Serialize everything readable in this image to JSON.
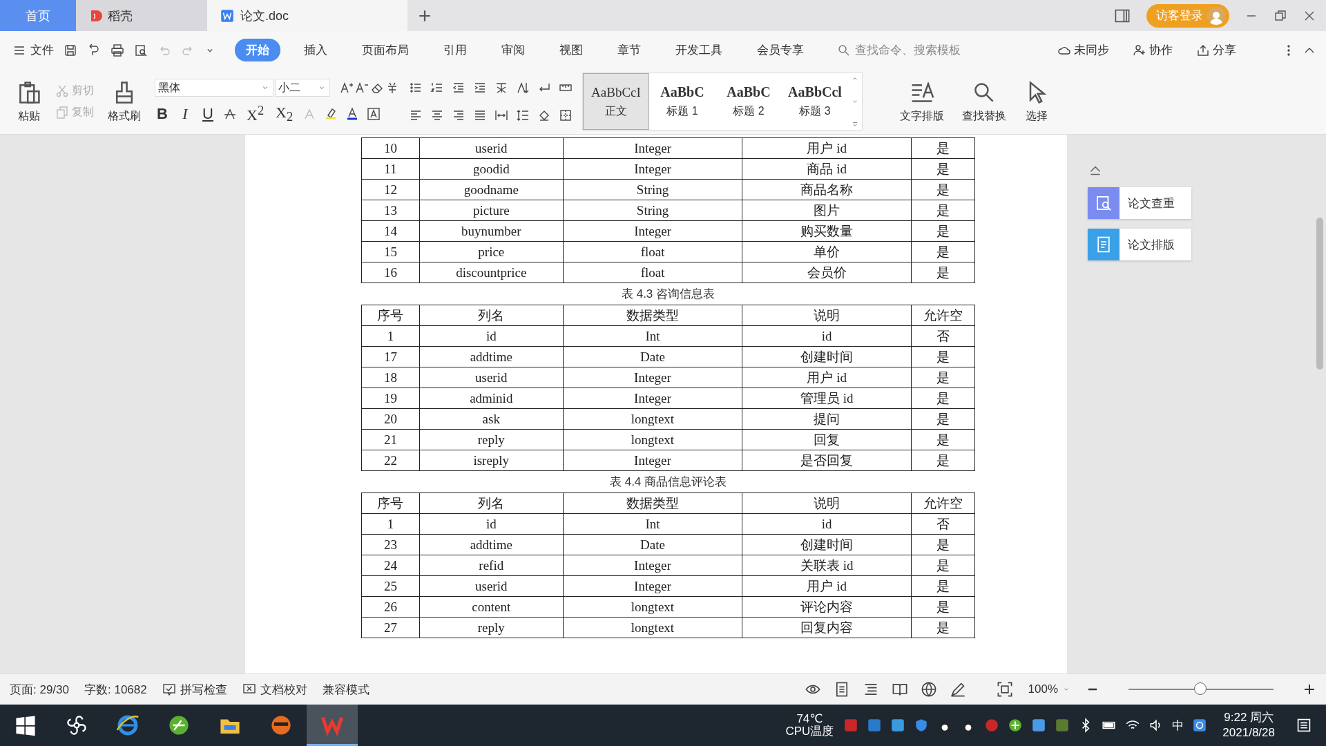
{
  "title_bar": {
    "tabs": [
      {
        "label": "首页",
        "kind": "home",
        "selected": false
      },
      {
        "label": "稻壳",
        "kind": "docer",
        "selected": false
      },
      {
        "label": "论文.doc",
        "kind": "doc",
        "selected": true
      }
    ],
    "login": "访客登录"
  },
  "menu_bar": {
    "file": "文件",
    "tabs": [
      {
        "label": "开始",
        "selected": true
      },
      {
        "label": "插入",
        "selected": false
      },
      {
        "label": "页面布局",
        "selected": false
      },
      {
        "label": "引用",
        "selected": false
      },
      {
        "label": "审阅",
        "selected": false
      },
      {
        "label": "视图",
        "selected": false
      },
      {
        "label": "章节",
        "selected": false
      },
      {
        "label": "开发工具",
        "selected": false
      },
      {
        "label": "会员专享",
        "selected": false
      }
    ],
    "search": {
      "placeholder": "查找命令、搜索模板"
    },
    "actions": [
      "未同步",
      "协作",
      "分享"
    ]
  },
  "ribbon": {
    "paste": "粘贴",
    "cut": {
      "label": "剪切",
      "disabled": true
    },
    "copy": {
      "label": "复制",
      "disabled": true
    },
    "format_painter": "格式刷",
    "font": "黑体",
    "font_size": "小二",
    "bold": "B",
    "italic": "I",
    "underline": "U",
    "superscript": "X$^{2}$",
    "subscript": "X$_{2}$",
    "styles": [
      {
        "preview": "AaBbCcI",
        "label": "正文",
        "selected": true
      },
      {
        "preview": "AaBbC",
        "label": "标题 1",
        "selected": false
      },
      {
        "preview": "AaBbC",
        "label": "标题 2",
        "selected": false
      },
      {
        "preview": "AaBbCcl",
        "label": "标题 3",
        "selected": false
      }
    ],
    "big_buttons": [
      "文字排版",
      "查找替换",
      "选择"
    ]
  },
  "document": {
    "tables": [
      {
        "rows": [
          [
            "10",
            "userid",
            "Integer",
            "用户 id",
            "是"
          ],
          [
            "11",
            "goodid",
            "Integer",
            "商品 id",
            "是"
          ],
          [
            "12",
            "goodname",
            "String",
            "商品名称",
            "是"
          ],
          [
            "13",
            "picture",
            "String",
            "图片",
            "是"
          ],
          [
            "14",
            "buynumber",
            "Integer",
            "购买数量",
            "是"
          ],
          [
            "15",
            "price",
            "float",
            "单价",
            "是"
          ],
          [
            "16",
            "discountprice",
            "float",
            "会员价",
            "是"
          ]
        ]
      },
      {
        "caption": "表 4.3 咨询信息表",
        "columns": [
          "序号",
          "列名",
          "数据类型",
          "说明",
          "允许空"
        ],
        "rows": [
          [
            "1",
            "id",
            "Int",
            "id",
            "否"
          ],
          [
            "17",
            "addtime",
            "Date",
            "创建时间",
            "是"
          ],
          [
            "18",
            "userid",
            "Integer",
            "用户 id",
            "是"
          ],
          [
            "19",
            "adminid",
            "Integer",
            "管理员 id",
            "是"
          ],
          [
            "20",
            "ask",
            "longtext",
            "提问",
            "是"
          ],
          [
            "21",
            "reply",
            "longtext",
            "回复",
            "是"
          ],
          [
            "22",
            "isreply",
            "Integer",
            "是否回复",
            "是"
          ]
        ]
      },
      {
        "caption": "表 4.4 商品信息评论表",
        "columns": [
          "序号",
          "列名",
          "数据类型",
          "说明",
          "允许空"
        ],
        "rows": [
          [
            "1",
            "id",
            "Int",
            "id",
            "否"
          ],
          [
            "23",
            "addtime",
            "Date",
            "创建时间",
            "是"
          ],
          [
            "24",
            "refid",
            "Integer",
            "关联表 id",
            "是"
          ],
          [
            "25",
            "userid",
            "Integer",
            "用户 id",
            "是"
          ],
          [
            "26",
            "content",
            "longtext",
            "评论内容",
            "是"
          ],
          [
            "27",
            "reply",
            "longtext",
            "回复内容",
            "是"
          ]
        ]
      }
    ]
  },
  "side_panel": [
    "论文查重",
    "论文排版"
  ],
  "status_bar": {
    "page": "页面: 29/30",
    "words": "字数: 10682",
    "spell": "拼写检查",
    "proof": "文档校对",
    "mode": "兼容模式",
    "zoom": "100%",
    "zoom_slider": {
      "level": 0.5
    }
  },
  "taskbar": {
    "cpu_temp": "74℃",
    "cpu_label": "CPU温度",
    "ime": "中",
    "time": "9:22 周六",
    "date": "2021/8/28"
  }
}
